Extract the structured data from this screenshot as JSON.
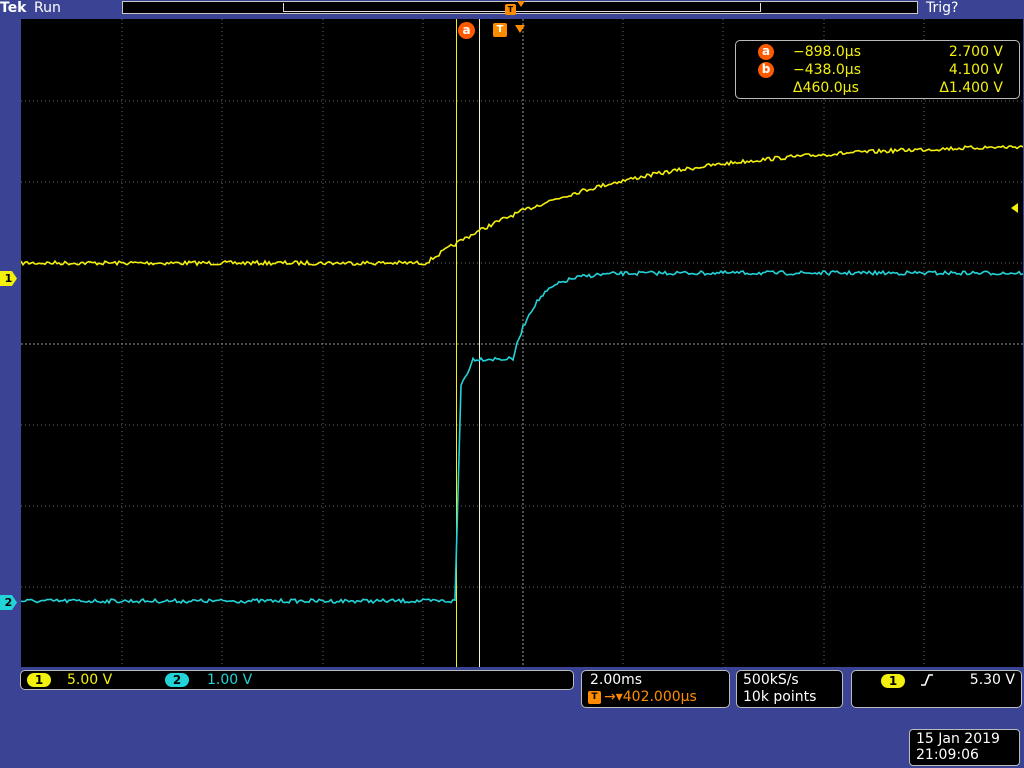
{
  "header": {
    "brand": "Tek",
    "run_state": "Run",
    "trigger_state": "Trig?"
  },
  "markers": {
    "ch1": "1",
    "ch2": "2",
    "cursor_a": "a",
    "cursor_b": "b",
    "trigger": "T"
  },
  "cursor_readout": {
    "a": {
      "time": "−898.0µs",
      "value": "2.700 V"
    },
    "b": {
      "time": "−438.0µs",
      "value": "4.100 V"
    },
    "delta": {
      "time": "Δ460.0µs",
      "value": "Δ1.400 V"
    }
  },
  "channels": {
    "ch1": {
      "label": "1",
      "scale": "5.00 V",
      "color": "#f3f00e"
    },
    "ch2": {
      "label": "2",
      "scale": "1.00 V",
      "color": "#22d3d8"
    }
  },
  "timebase": {
    "scale": "2.00ms",
    "trigger_position": "→▾402.000µs"
  },
  "acquisition": {
    "sample_rate": "500kS/s",
    "record_length": "10k points"
  },
  "trigger": {
    "source": "1",
    "slope": "rising-edge-icon",
    "level": "5.30 V"
  },
  "datetime": {
    "date": "15 Jan  2019",
    "time": "21:09:06"
  },
  "colors": {
    "background": "#3a4394",
    "screen": "#000000",
    "ch1": "#f3f00e",
    "ch2": "#22d3d8",
    "cursor": "#ff5a00",
    "trigger": "#ff8c00"
  }
}
